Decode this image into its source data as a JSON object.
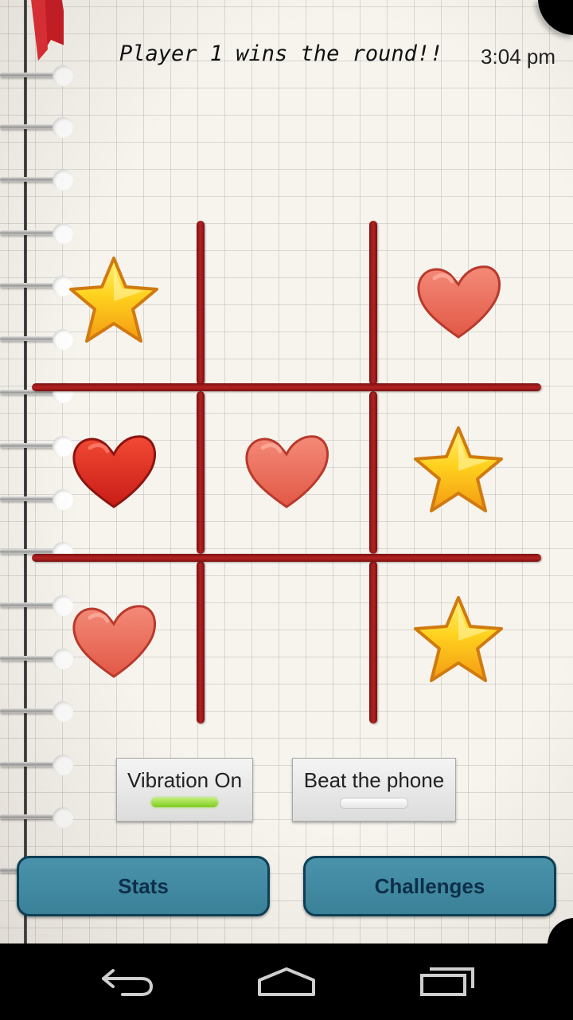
{
  "header": {
    "status_message": "Player 1 wins the round!!",
    "time": "3:04 pm"
  },
  "board": {
    "cells": [
      {
        "row": 1,
        "col": 1,
        "piece": "star-icon"
      },
      {
        "row": 1,
        "col": 2,
        "piece": "empty"
      },
      {
        "row": 1,
        "col": 3,
        "piece": "heart-icon"
      },
      {
        "row": 2,
        "col": 1,
        "piece": "heart-icon"
      },
      {
        "row": 2,
        "col": 2,
        "piece": "heart-icon"
      },
      {
        "row": 2,
        "col": 3,
        "piece": "star-icon"
      },
      {
        "row": 3,
        "col": 1,
        "piece": "heart-icon"
      },
      {
        "row": 3,
        "col": 2,
        "piece": "empty"
      },
      {
        "row": 3,
        "col": 3,
        "piece": "star-icon"
      }
    ]
  },
  "toggles": {
    "vibration": {
      "label": "Vibration On",
      "state": "on"
    },
    "beat_phone": {
      "label": "Beat the phone",
      "state": "off"
    }
  },
  "buttons": {
    "stats": "Stats",
    "challenges": "Challenges"
  },
  "navbar": {
    "back_icon": "back-arrow-icon",
    "home_icon": "home-icon",
    "recents_icon": "recent-apps-icon"
  },
  "colors": {
    "grid_line": "#b52222",
    "button_fill": "#4089a1",
    "button_border": "#0d3f55",
    "toggle_on": "#7ecb1f",
    "star": "#ffd21e",
    "heart_dark": "#e0261f",
    "heart_light": "#ef6a5a"
  }
}
